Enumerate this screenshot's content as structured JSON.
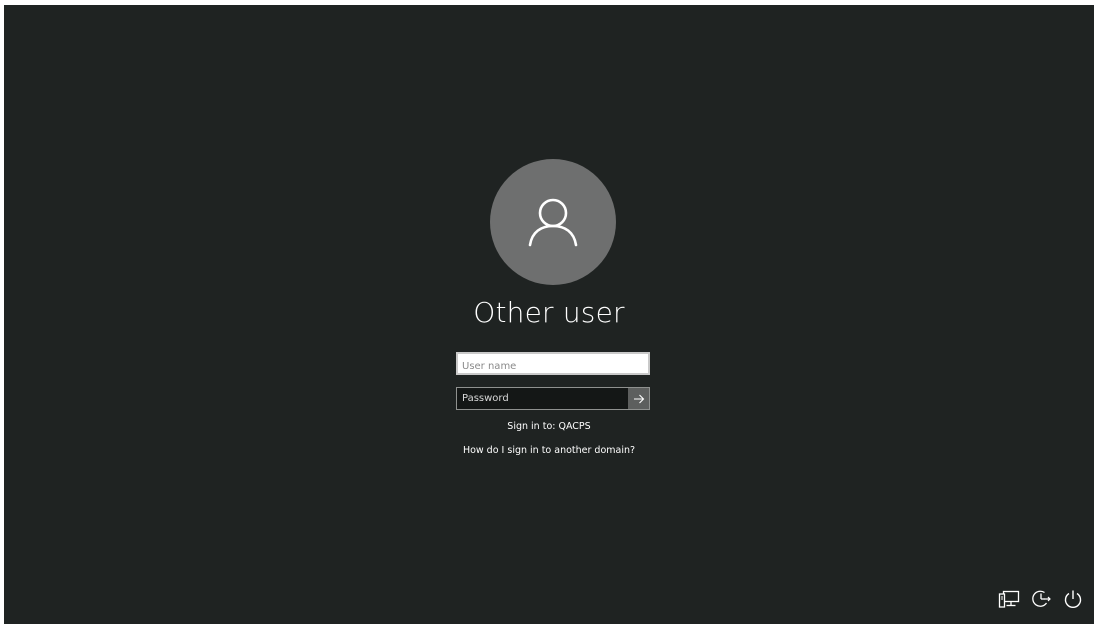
{
  "user": {
    "name": "Other user",
    "avatar_icon": "person-icon"
  },
  "form": {
    "username_placeholder": "User name",
    "username_value": "",
    "password_placeholder": "Password",
    "password_value": "",
    "submit_icon": "arrow-right-icon"
  },
  "sign_in_to": "Sign in to: QACPS",
  "other_domain_link": "How do I sign in to another domain?",
  "corner_icons": [
    "network-icon",
    "ease-of-access-icon",
    "power-icon"
  ],
  "colors": {
    "background": "#1f2322",
    "avatar": "#6e6f6f",
    "submit_button": "#5d5f5e"
  }
}
